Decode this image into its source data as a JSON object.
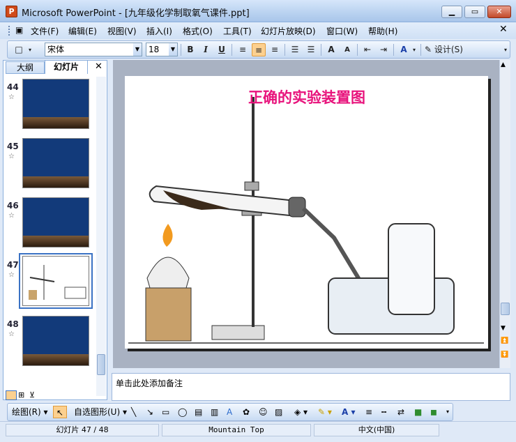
{
  "window": {
    "title": "Microsoft PowerPoint - [九年级化学制取氧气课件.ppt]",
    "app_icon": "powerpoint-icon"
  },
  "menu": [
    "文件(F)",
    "编辑(E)",
    "视图(V)",
    "插入(I)",
    "格式(O)",
    "工具(T)",
    "幻灯片放映(D)",
    "窗口(W)",
    "帮助(H)"
  ],
  "toolbar": {
    "font_name": "宋体",
    "font_size": "18",
    "bold": "B",
    "italic": "I",
    "underline": "U",
    "design_label": "设计(S)"
  },
  "left_pane": {
    "tab_outline": "大纲",
    "tab_slides": "幻灯片",
    "slides": [
      {
        "number": "44"
      },
      {
        "number": "45"
      },
      {
        "number": "46"
      },
      {
        "number": "47"
      },
      {
        "number": "48"
      }
    ],
    "selected": "47"
  },
  "slide": {
    "title": "正确的实验装置图"
  },
  "notes": {
    "placeholder": "单击此处添加备注"
  },
  "drawing_toolbar": {
    "draw_label": "绘图(R)",
    "autoshapes_label": "自选图形(U)"
  },
  "status": {
    "slide_position": "幻灯片 47 / 48",
    "design": "Mountain Top",
    "language": "中文(中国)"
  }
}
